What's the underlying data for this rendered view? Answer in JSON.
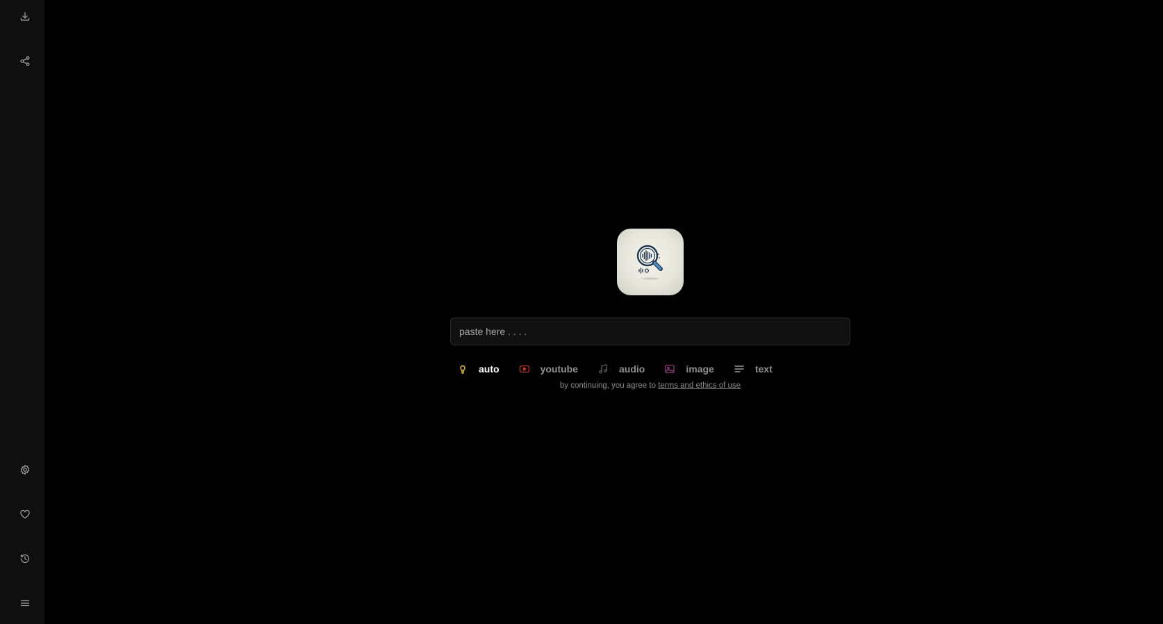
{
  "sidebar": {
    "top_buttons": [
      {
        "icon": "download-icon"
      },
      {
        "icon": "share-icon"
      }
    ],
    "bottom_buttons": [
      {
        "icon": "gear-icon"
      },
      {
        "icon": "heart-icon"
      },
      {
        "icon": "history-icon"
      },
      {
        "icon": "menu-icon"
      }
    ]
  },
  "main": {
    "logo": {
      "icon": "magnifier-soundwave-icon"
    },
    "search": {
      "placeholder": "paste here . . . .",
      "value": ""
    },
    "modes": [
      {
        "label": "auto",
        "icon": "lightbulb-icon",
        "color": "#f5c542",
        "active": true
      },
      {
        "label": "youtube",
        "icon": "youtube-icon",
        "color": "#c0392b",
        "active": false
      },
      {
        "label": "audio",
        "icon": "music-note-icon",
        "color": "#5a5a5a",
        "active": false
      },
      {
        "label": "image",
        "icon": "image-icon",
        "color": "#8e3a7a",
        "active": false
      },
      {
        "label": "text",
        "icon": "text-lines-icon",
        "color": "#9a9a9a",
        "active": false
      }
    ],
    "terms": {
      "prefix": "by continuing, you agree to ",
      "link": "terms and ethics of use"
    }
  },
  "colors": {
    "background": "#000000",
    "sidebar": "#0f0f0f",
    "input_bg": "#111111",
    "input_border": "#2c2c2c"
  }
}
